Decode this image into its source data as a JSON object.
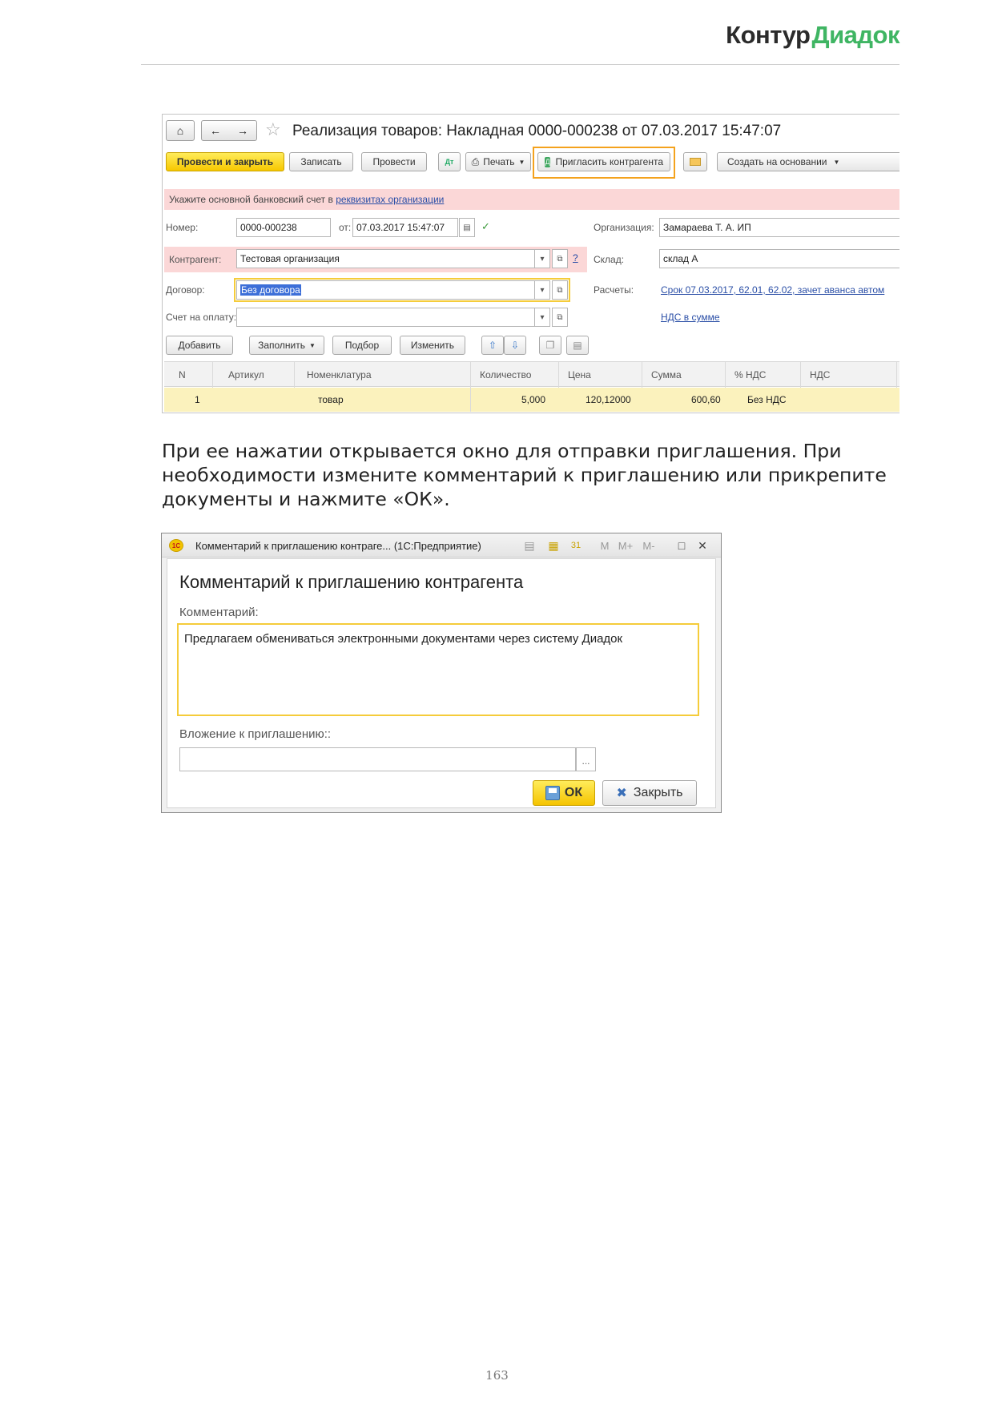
{
  "header": {
    "brand_part1": "Контур",
    "brand_part2": "Диадок"
  },
  "form": {
    "title": "Реализация товаров: Накладная 0000-000238 от 07.03.2017 15:47:07",
    "toolbar": {
      "post_close": "Провести и закрыть",
      "save": "Записать",
      "post": "Провести",
      "print": "Печать",
      "invite": "Пригласить контрагента",
      "create_based": "Создать на основании"
    },
    "warning_text": "Укажите основной банковский счет в ",
    "warning_link": "реквизитах организации",
    "fields": {
      "number_label": "Номер:",
      "number_value": "0000-000238",
      "date_label": "от:",
      "date_value": "07.03.2017 15:47:07",
      "org_label": "Организация:",
      "org_value": "Замараева Т. А. ИП",
      "counterparty_label": "Контрагент:",
      "counterparty_value": "Тестовая организация",
      "warehouse_label": "Склад:",
      "warehouse_value": "склад А",
      "contract_label": "Договор:",
      "contract_value": "Без договора",
      "settlements_label": "Расчеты:",
      "settlements_link": "Срок 07.03.2017, 62.01, 62.02, зачет аванса автом",
      "invoice_label": "Счет на оплату:",
      "invoice_value": "",
      "vat_link": "НДС в сумме"
    },
    "table_toolbar": {
      "add": "Добавить",
      "fill": "Заполнить",
      "select": "Подбор",
      "change": "Изменить"
    },
    "table": {
      "columns": [
        "N",
        "Артикул",
        "Номенклатура",
        "Количество",
        "Цена",
        "Сумма",
        "% НДС",
        "НДС"
      ],
      "rows": [
        {
          "n": "1",
          "article": "",
          "item": "товар",
          "qty": "5,000",
          "price": "120,12000",
          "sum": "600,60",
          "vat_rate": "Без НДС",
          "vat": ""
        }
      ]
    }
  },
  "paragraph": "При ее нажатии открывается окно для отправки приглашения. При необходимости измените комментарий к приглашению или прикрепите документы и нажмите «ОК».",
  "dialog": {
    "window_title": "Комментарий к приглашению контраге...  (1С:Предприятие)",
    "heading": "Комментарий к приглашению контрагента",
    "comment_label": "Комментарий:",
    "comment_value": "Предлагаем обмениваться электронными документами через систему Диадок",
    "attachment_label": "Вложение к приглашению::",
    "attachment_value": "",
    "ok": "ОК",
    "close": "Закрыть",
    "title_icons": {
      "m": "M",
      "m_plus": "M+",
      "m_minus": "M-"
    }
  },
  "page_number": "163"
}
